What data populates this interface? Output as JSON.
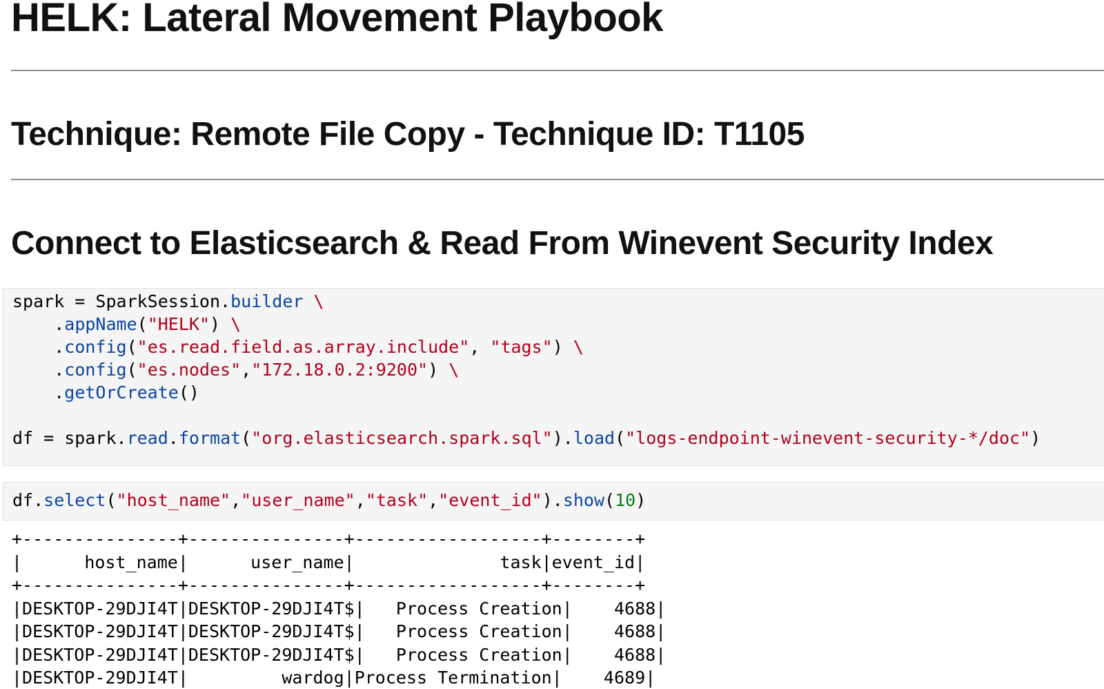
{
  "page": {
    "title": "HELK: Lateral Movement Playbook",
    "technique": {
      "label": "Technique:",
      "value": " Remote File Copy - ",
      "id_label": "Technique ID:",
      "id_value": " T1105"
    },
    "section_heading": "Connect to Elasticsearch & Read From Winevent Security Index"
  },
  "cell1": {
    "l1": {
      "a": "spark = SparkSession.",
      "b": "builder",
      "c": " ",
      "d": "\\"
    },
    "l2": {
      "a": "    .",
      "b": "appName",
      "c": "(",
      "d": "\"HELK\"",
      "e": ") ",
      "f": "\\"
    },
    "l3": {
      "a": "    .",
      "b": "config",
      "c": "(",
      "d": "\"es.read.field.as.array.include\"",
      "e": ", ",
      "f": "\"tags\"",
      "g": ") ",
      "h": "\\"
    },
    "l4": {
      "a": "    .",
      "b": "config",
      "c": "(",
      "d": "\"es.nodes\"",
      "e": ",",
      "f": "\"172.18.0.2:9200\"",
      "g": ") ",
      "h": "\\"
    },
    "l5": {
      "a": "    .",
      "b": "getOrCreate",
      "c": "()"
    },
    "l7": {
      "a": "df = spark.",
      "b": "read",
      "c": ".",
      "d": "format",
      "e": "(",
      "f": "\"org.elasticsearch.spark.sql\"",
      "g": ").",
      "h": "load",
      "i": "(",
      "j": "\"logs-endpoint-winevent-security-*/doc\"",
      "k": ")"
    }
  },
  "cell2": {
    "l1": {
      "a": "df.",
      "b": "select",
      "c": "(",
      "d": "\"host_name\"",
      "e": ",",
      "f": "\"user_name\"",
      "g": ",",
      "h": "\"task\"",
      "i": ",",
      "j": "\"event_id\"",
      "k": ").",
      "l": "show",
      "m": "(",
      "n": "10",
      "o": ")"
    }
  },
  "output": {
    "border": "+---------------+---------------+------------------+--------+",
    "header": "|      host_name|      user_name|              task|event_id|",
    "rows": [
      "|DESKTOP-29DJI4T|DESKTOP-29DJI4T$|   Process Creation|    4688|",
      "|DESKTOP-29DJI4T|DESKTOP-29DJI4T$|   Process Creation|    4688|",
      "|DESKTOP-29DJI4T|DESKTOP-29DJI4T$|   Process Creation|    4688|",
      "|DESKTOP-29DJI4T|         wardog|Process Termination|    4689|"
    ]
  },
  "colors": {
    "keyword": "#0b44a0",
    "string": "#b3001b",
    "number": "#0d7a16",
    "cell_bg": "#f5f5f5"
  }
}
